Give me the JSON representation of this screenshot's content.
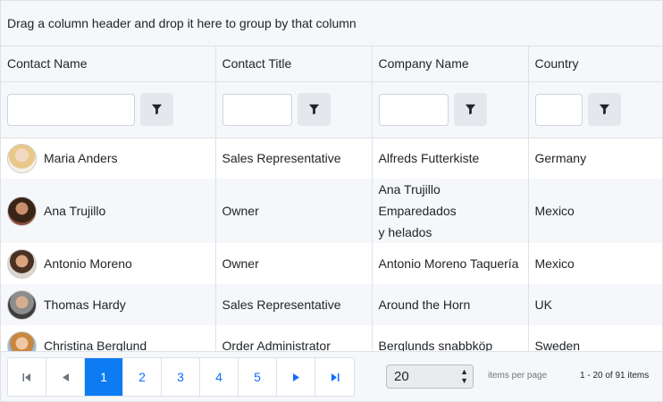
{
  "group_panel": {
    "text": "Drag a column header and drop it here to group by that column"
  },
  "columns": [
    "Contact Name",
    "Contact Title",
    "Company Name",
    "Country"
  ],
  "rows": [
    {
      "name": "Maria Anders",
      "title": "Sales Representative",
      "company": "Alfreds Futterkiste",
      "country": "Germany"
    },
    {
      "name": "Ana Trujillo",
      "title": "Owner",
      "company_line1": "Ana Trujillo Emparedados",
      "company_line2": "y helados",
      "country": "Mexico"
    },
    {
      "name": "Antonio Moreno",
      "title": "Owner",
      "company": "Antonio Moreno Taquería",
      "country": "Mexico"
    },
    {
      "name": "Thomas Hardy",
      "title": "Sales Representative",
      "company": "Around the Horn",
      "country": "UK"
    },
    {
      "name": "Christina Berglund",
      "title": "Order Administrator",
      "company": "Berglunds snabbköp",
      "country": "Sweden"
    }
  ],
  "pager": {
    "pages": [
      "1",
      "2",
      "3",
      "4",
      "5"
    ],
    "current_page": "1",
    "page_size": "20",
    "items_per_page_label": "items per page",
    "info": "1 - 20 of 91 items"
  },
  "colors": {
    "accent": "#0d7cf2",
    "header_bg": "#f5f7fa",
    "border": "#dee2e6"
  },
  "icons": {
    "filter": "filter-icon",
    "first": "first-page-icon",
    "prev": "prev-page-icon",
    "next": "next-page-icon",
    "last": "last-page-icon"
  }
}
